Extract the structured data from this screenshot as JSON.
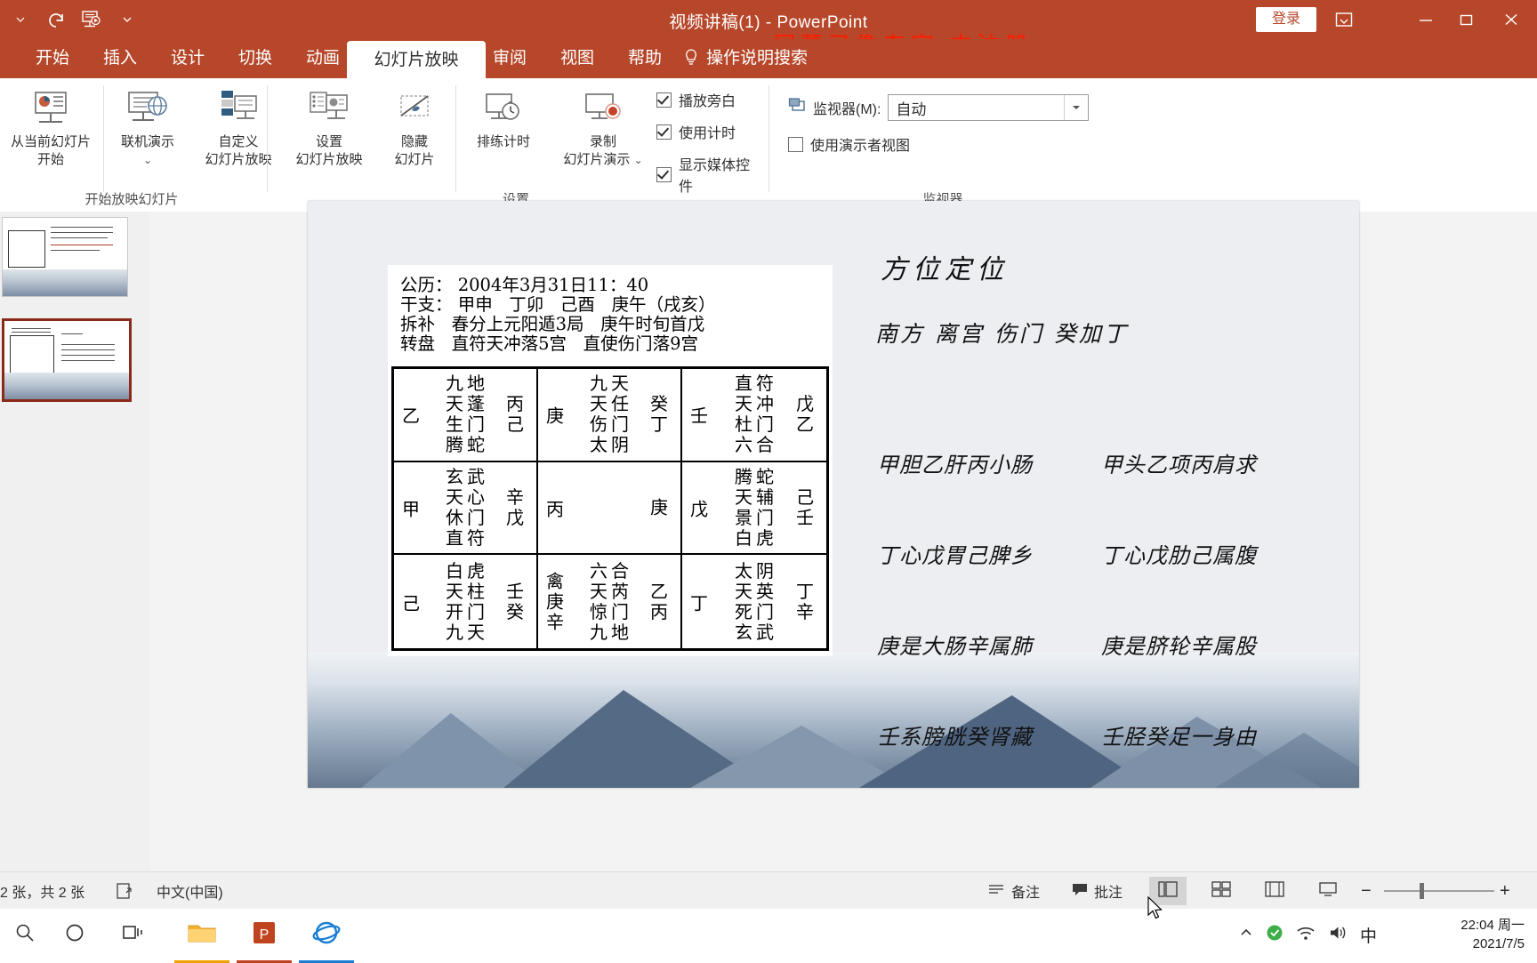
{
  "titlebar": {
    "app_title": "视频讲稿(1)  -  PowerPoint",
    "watermark": "屏幕录像专家  未注册",
    "signin_label": "登录",
    "icons": {
      "undo": "undo-icon",
      "slideshow": "start-slideshow-icon",
      "qat_more": "chevron-down-icon",
      "ribbon_display": "ribbon-display-options-icon",
      "minimize": "minimize-icon",
      "restore": "restore-icon",
      "close": "close-icon"
    }
  },
  "ribbon_tabs": [
    {
      "label": "开始",
      "active": false
    },
    {
      "label": "插入",
      "active": false
    },
    {
      "label": "设计",
      "active": false
    },
    {
      "label": "切换",
      "active": false
    },
    {
      "label": "动画",
      "active": false
    },
    {
      "label": "幻灯片放映",
      "active": true
    },
    {
      "label": "审阅",
      "active": false
    },
    {
      "label": "视图",
      "active": false
    },
    {
      "label": "帮助",
      "active": false
    }
  ],
  "tell_me": {
    "label": "操作说明搜索",
    "icon": "lightbulb-icon"
  },
  "ribbon": {
    "groups": [
      {
        "name": "开始放映幻灯片",
        "buttons": [
          {
            "label": "从当前幻灯片\n开始",
            "icon": "present-from-current-icon"
          },
          {
            "label": "联机演示",
            "icon": "present-online-icon",
            "dropdown": true
          },
          {
            "label": "自定义\n幻灯片放映",
            "icon": "custom-slideshow-icon",
            "dropdown": true
          }
        ]
      },
      {
        "name": "设置",
        "buttons": [
          {
            "label": "设置\n幻灯片放映",
            "icon": "setup-slideshow-icon"
          },
          {
            "label": "隐藏\n幻灯片",
            "icon": "hide-slide-icon"
          },
          {
            "label": "排练计时",
            "icon": "rehearse-timings-icon"
          },
          {
            "label": "录制\n幻灯片演示",
            "icon": "record-slideshow-icon",
            "dropdown": true
          }
        ],
        "checkboxes": [
          {
            "label": "播放旁白",
            "checked": true
          },
          {
            "label": "使用计时",
            "checked": true
          },
          {
            "label": "显示媒体控件",
            "checked": true
          }
        ]
      },
      {
        "name": "监视器",
        "monitor_label": "监视器(M):",
        "monitor_icon": "monitor-icon",
        "monitor_value": "自动",
        "presenter_view": {
          "label": "使用演示者视图",
          "checked": false
        }
      }
    ]
  },
  "thumbnails": [
    {
      "index": "1",
      "selected": false
    },
    {
      "index": "2",
      "selected": true
    }
  ],
  "slide": {
    "header_lines": [
      "公历： 2004年3月31日11：40",
      "干支： 甲申   丁卯   己酉   庚午（戌亥）",
      "拆补   春分上元阳遁3局   庚午时旬首戊",
      "转盘   直符天冲落5宫   直使伤门落9宫"
    ],
    "grid": [
      {
        "left": "乙",
        "mid_col1": "九\n天\n生\n腾",
        "mid_col2": "地\n蓬\n门\n蛇",
        "right": "丙\n己"
      },
      {
        "left": "庚",
        "mid_col1": "九\n天\n伤\n太",
        "mid_col2": "天\n任\n门\n阴",
        "right": "癸\n丁"
      },
      {
        "left": "壬",
        "mid_col1": "直\n天\n杜\n六",
        "mid_col2": "符\n冲\n门\n合",
        "right": "戊\n乙"
      },
      {
        "left": "甲",
        "mid_col1": "玄\n天\n休\n直",
        "mid_col2": "武\n心\n门\n符",
        "right": "辛\n戊"
      },
      {
        "left": "丙",
        "mid_col1": "",
        "mid_col2": "",
        "right": "庚"
      },
      {
        "left": "戊",
        "mid_col1": "腾\n天\n景\n白",
        "mid_col2": "蛇\n辅\n门\n虎",
        "right": "己\n壬"
      },
      {
        "left": "己",
        "mid_col1": "白\n天\n开\n九",
        "mid_col2": "虎\n柱\n门\n天",
        "right": "壬\n癸"
      },
      {
        "left": "禽\n庚\n辛",
        "mid_col1": "六\n天\n惊\n九",
        "mid_col2": "合\n芮\n门\n地",
        "right": "乙\n丙"
      },
      {
        "left": "丁",
        "mid_col1": "太\n天\n死\n玄",
        "mid_col2": "阴\n英\n门\n武",
        "right": "丁\n辛"
      }
    ],
    "right_panel": {
      "title": "方位定位",
      "subtitle": "南方 离宫 伤门 癸加丁",
      "verses": [
        [
          "甲胆乙肝丙小肠",
          "甲头乙项丙肩求"
        ],
        [
          "丁心戊胃己脾乡",
          "丁心戊肋己属腹"
        ],
        [
          "庚是大肠辛属肺",
          "庚是脐轮辛属股"
        ],
        [
          "壬系膀胱癸肾藏",
          "壬胫癸足一身由"
        ]
      ]
    }
  },
  "statusbar": {
    "slide_count": "2 张，共 2 张",
    "language": "中文(中国)",
    "notes_label": "备注",
    "comments_label": "批注",
    "accessibility_icon": "accessibility-icon",
    "notes_icon": "notes-icon",
    "comments_icon": "comments-icon",
    "views": [
      {
        "name": "normal-view",
        "icon": "normal-view-icon",
        "active": true
      },
      {
        "name": "slide-sorter-view",
        "icon": "slide-sorter-icon",
        "active": false
      },
      {
        "name": "reading-view",
        "icon": "reading-view-icon",
        "active": false
      },
      {
        "name": "slideshow-view",
        "icon": "slideshow-view-icon",
        "active": false
      }
    ],
    "zoom_out": "−",
    "zoom_in": "+",
    "fit_icon": "fit-slide-icon"
  },
  "taskbar": {
    "items": [
      {
        "name": "search",
        "icon": "search-icon"
      },
      {
        "name": "cortana",
        "icon": "circle-icon"
      },
      {
        "name": "task-view",
        "icon": "task-view-icon"
      },
      {
        "name": "file-explorer",
        "icon": "folder-icon"
      },
      {
        "name": "powerpoint",
        "icon": "powerpoint-icon"
      },
      {
        "name": "internet-explorer",
        "icon": "ie-icon"
      }
    ],
    "tray": {
      "chevron": "show-hidden-icons-icon",
      "shield": "security-icon",
      "network": "wifi-icon",
      "volume": "volume-icon",
      "ime": "中"
    },
    "clock_time": "22:04 周一",
    "clock_date": "2021/7/5"
  }
}
